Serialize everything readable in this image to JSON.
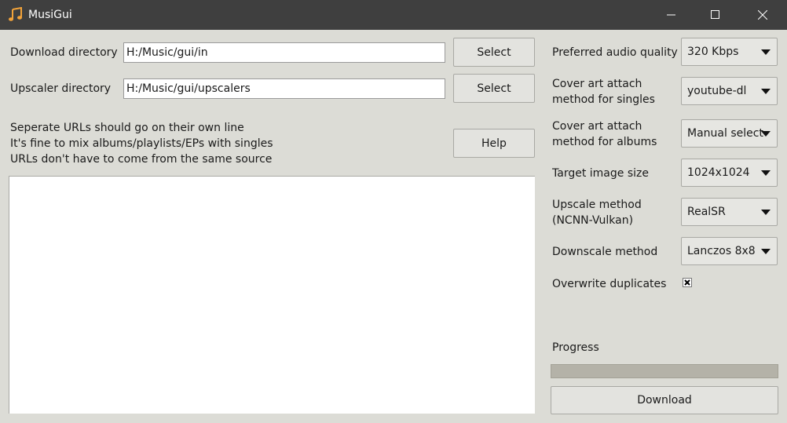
{
  "window": {
    "title": "MusiGui",
    "icon": "music-note-icon"
  },
  "left": {
    "download_dir": {
      "label": "Download directory",
      "value": "H:/Music/gui/in",
      "button": "Select"
    },
    "upscaler_dir": {
      "label": "Upscaler directory",
      "value": "H:/Music/gui/upscalers",
      "button": "Select"
    },
    "instructions": [
      "Seperate URLs should go on their own line",
      "It's fine to mix albums/playlists/EPs with singles",
      "URLs don't have to come from the same source"
    ],
    "help_button": "Help",
    "urls_value": ""
  },
  "settings": {
    "audio_quality": {
      "label": "Preferred audio quality",
      "value": "320 Kbps"
    },
    "cover_singles": {
      "label_line1": "Cover art attach",
      "label_line2": "method for singles",
      "value": "youtube-dl"
    },
    "cover_albums": {
      "label_line1": "Cover art attach",
      "label_line2": "method for albums",
      "value": "Manual select"
    },
    "image_size": {
      "label": "Target image size",
      "value": "1024x1024"
    },
    "upscale": {
      "label_line1": "Upscale method",
      "label_line2": "(NCNN-Vulkan)",
      "value": "RealSR"
    },
    "downscale": {
      "label": "Downscale method",
      "value": "Lanczos 8x8"
    },
    "overwrite": {
      "label": "Overwrite duplicates",
      "checked": "x"
    }
  },
  "progress": {
    "label": "Progress",
    "value": 0
  },
  "download_button": "Download",
  "colors": {
    "titlebar": "#3f3f3f",
    "window_bg": "#dcdcd6",
    "icon_orange": "#f2a33a"
  }
}
